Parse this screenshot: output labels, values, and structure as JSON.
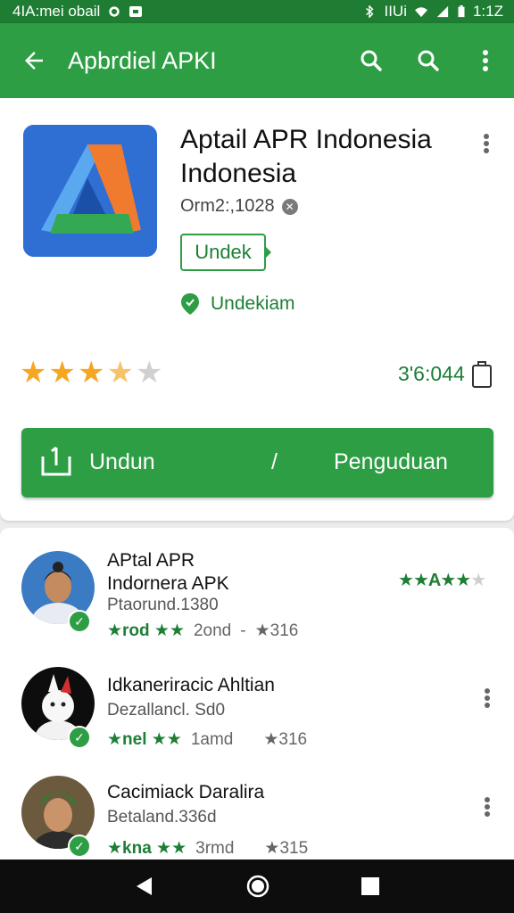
{
  "status_bar": {
    "left_text": "4IA:mei obail",
    "time": "1:1Z",
    "network": "IIUi"
  },
  "app_bar": {
    "title": "Apbrdiel APKI",
    "icons": [
      "back-arrow-icon",
      "search-icon",
      "search-icon",
      "more-vert-icon"
    ]
  },
  "app": {
    "title": "Aptail APR Indonesia Indonesia",
    "developer": "Orm2:,1028",
    "action_button": "Undek",
    "location": "Undekiam",
    "rating_stars": 3.5,
    "rating_count": "3'6:044",
    "install_left": "Undun",
    "install_sep": "/",
    "install_right": "Penguduan"
  },
  "reviews": [
    {
      "title": "APtal APR\nIndornera APK",
      "subtitle": "Ptaorund.1380",
      "meta_stars": "★rod ★★",
      "meta_date": "2ond",
      "meta_sep": "-",
      "meta_count": "★316",
      "stars": "★★A★★★",
      "has_menu": false
    },
    {
      "title": "Idkaneriracic Ahltian",
      "subtitle": "Dezallancl. Sd0",
      "meta_stars": "★nel ★★",
      "meta_date": "1amd",
      "meta_sep": "",
      "meta_count": "★316",
      "has_menu": true
    },
    {
      "title": "Cacimiack Daralira",
      "subtitle": "Betaland.336d",
      "meta_stars": "★kna ★★",
      "meta_date": "3rmd",
      "meta_sep": "",
      "meta_count": "★315",
      "has_menu": true
    }
  ],
  "colors": {
    "primary": "#2e9e45",
    "primary_dark": "#1e7d32",
    "star": "#f5a623",
    "text_green": "#1d7f35"
  }
}
